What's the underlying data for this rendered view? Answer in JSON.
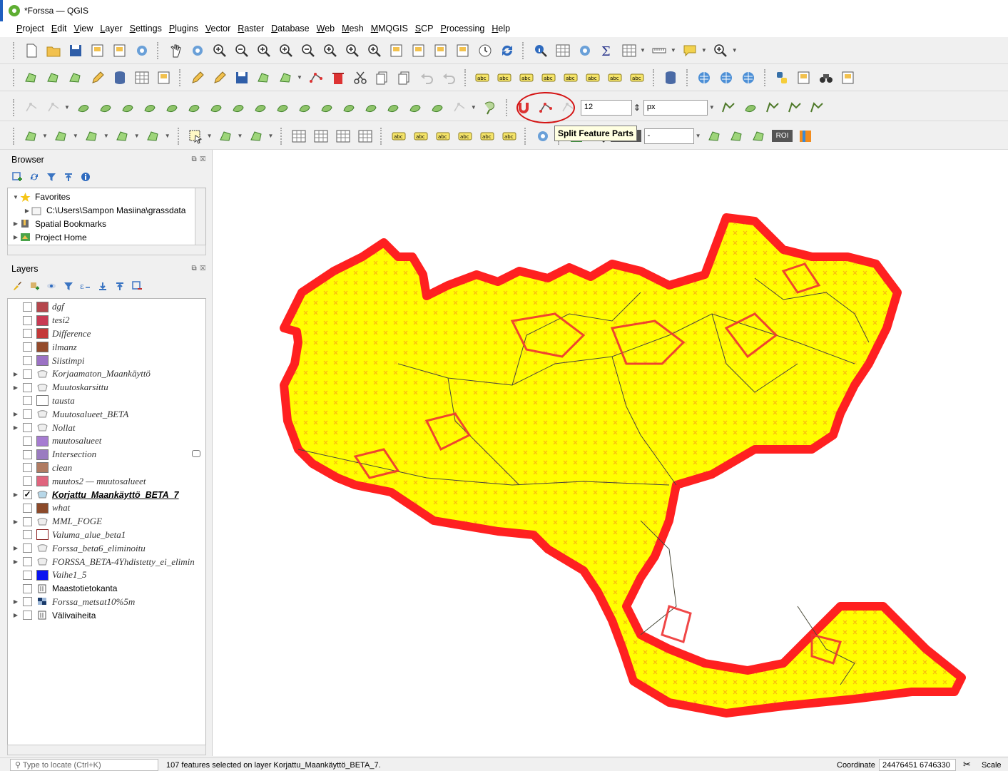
{
  "window": {
    "title": "*Forssa — QGIS"
  },
  "menu": [
    {
      "label": "Project"
    },
    {
      "label": "Edit"
    },
    {
      "label": "View"
    },
    {
      "label": "Layer"
    },
    {
      "label": "Settings"
    },
    {
      "label": "Plugins"
    },
    {
      "label": "Vector"
    },
    {
      "label": "Raster"
    },
    {
      "label": "Database"
    },
    {
      "label": "Web"
    },
    {
      "label": "Mesh"
    },
    {
      "label": "MMQGIS"
    },
    {
      "label": "SCP"
    },
    {
      "label": "Processing"
    },
    {
      "label": "Help"
    }
  ],
  "toolbar3": {
    "snap_size": "12",
    "snap_unit": "px"
  },
  "toolbar4": {
    "rgb_label": "RGB =",
    "rgb_value": "-",
    "roi_label": "ROI"
  },
  "tooltip": "Split Feature Parts",
  "browser": {
    "title": "Browser",
    "items": [
      {
        "label": "Favorites"
      },
      {
        "label": "C:\\Users\\Sampon Masiina\\grassdata"
      },
      {
        "label": "Spatial Bookmarks"
      },
      {
        "label": "Project Home"
      }
    ]
  },
  "layers": {
    "title": "Layers",
    "items": [
      {
        "label": "dgf",
        "color": "#b5474d",
        "checked": false,
        "expand": false,
        "type": "fill"
      },
      {
        "label": "tesi2",
        "color": "#c83a54",
        "checked": false,
        "expand": false,
        "type": "fill"
      },
      {
        "label": "Difference",
        "color": "#c43939",
        "checked": false,
        "expand": false,
        "type": "fill"
      },
      {
        "label": "ilmanz",
        "color": "#944b2c",
        "checked": false,
        "expand": false,
        "type": "fill"
      },
      {
        "label": "Siistimpi",
        "color": "#9b72c4",
        "checked": false,
        "expand": false,
        "type": "fill"
      },
      {
        "label": "Korjaamaton_Maankäyttö",
        "color": "",
        "checked": false,
        "expand": true,
        "type": "group"
      },
      {
        "label": "Muutoskarsittu",
        "color": "",
        "checked": false,
        "expand": true,
        "type": "group"
      },
      {
        "label": "tausta",
        "color": "#ffffff",
        "checked": false,
        "expand": false,
        "type": "fill"
      },
      {
        "label": "Muutosalueet_BETA",
        "color": "",
        "checked": false,
        "expand": true,
        "type": "group"
      },
      {
        "label": "Nollat",
        "color": "",
        "checked": false,
        "expand": true,
        "type": "group"
      },
      {
        "label": "muutosalueet",
        "color": "#a67cd1",
        "checked": false,
        "expand": false,
        "type": "fill"
      },
      {
        "label": "Intersection",
        "color": "#9a7bc0",
        "checked": false,
        "expand": false,
        "type": "fill"
      },
      {
        "label": "clean",
        "color": "#b07b62",
        "checked": false,
        "expand": false,
        "type": "fill"
      },
      {
        "label": "muutos2 — muutosalueet",
        "color": "#e0657e",
        "checked": false,
        "expand": false,
        "type": "fill"
      },
      {
        "label": "Korjattu_Maankäyttö_BETA_7",
        "color": "",
        "checked": true,
        "expand": true,
        "type": "group-active"
      },
      {
        "label": "what",
        "color": "#8c4a2a",
        "checked": false,
        "expand": false,
        "type": "fill"
      },
      {
        "label": "MML_FOGE",
        "color": "",
        "checked": false,
        "expand": true,
        "type": "group"
      },
      {
        "label": "Valuma_alue_beta1",
        "color": "#ffffff",
        "checked": false,
        "expand": false,
        "type": "outline"
      },
      {
        "label": "Forssa_beta6_eliminoitu",
        "color": "",
        "checked": false,
        "expand": true,
        "type": "group"
      },
      {
        "label": "FORSSA_BETA-4Yhdistetty_ei_elimin",
        "color": "",
        "checked": false,
        "expand": true,
        "type": "group"
      },
      {
        "label": "Vaihe1_5",
        "color": "#0a14f0",
        "checked": false,
        "expand": false,
        "type": "fill"
      },
      {
        "label": "Maastotietokanta",
        "color": "",
        "checked": false,
        "expand": false,
        "type": "folder"
      },
      {
        "label": "Forssa_metsat10%5m",
        "color": "",
        "checked": false,
        "expand": true,
        "type": "raster"
      },
      {
        "label": "Välivaiheita",
        "color": "",
        "checked": false,
        "expand": true,
        "type": "folder"
      }
    ]
  },
  "status": {
    "locate_placeholder": "Type to locate (Ctrl+K)",
    "message": "107 features selected on layer Korjattu_Maankäyttö_BETA_7.",
    "coordinate_label": "Coordinate",
    "coordinate_value": "24476451 6746330",
    "scale_label": "Scale"
  },
  "colors": {
    "polygon_fill": "#ffff00",
    "outline": "#ff2020",
    "vertex": "#ee3333"
  }
}
